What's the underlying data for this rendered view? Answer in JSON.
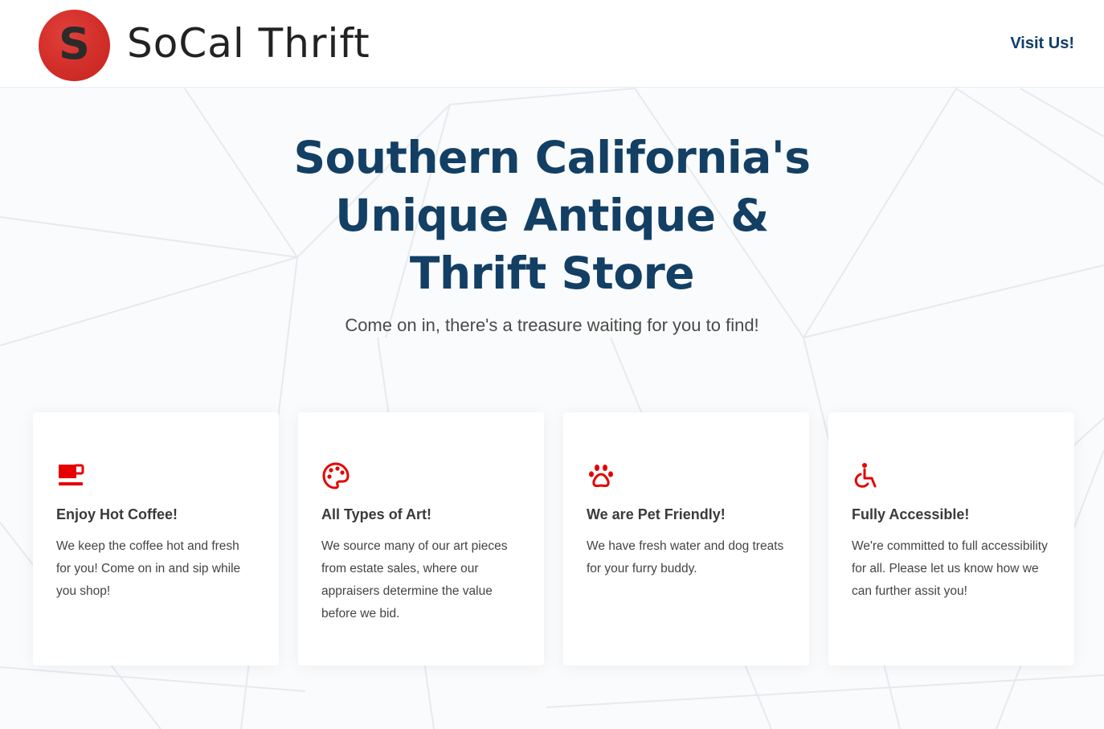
{
  "header": {
    "logo_letter": "S",
    "logo_text": "SoCal Thrift",
    "visit_link": "Visit Us!"
  },
  "hero": {
    "title": "Southern California's Unique Antique & Thrift Store",
    "subtitle": "Come on in, there's a treasure waiting for you to find!"
  },
  "features": [
    {
      "icon": "coffee-cup-icon",
      "title": "Enjoy Hot Coffee!",
      "text": "We keep the coffee hot and fresh for you! Come on in and sip while you shop!"
    },
    {
      "icon": "palette-icon",
      "title": "All Types of Art!",
      "text": "We source many of our art pieces from estate sales, where our appraisers determine the value before we bid."
    },
    {
      "icon": "paw-icon",
      "title": "We are Pet Friendly!",
      "text": "We have fresh water and dog treats for your furry buddy."
    },
    {
      "icon": "wheelchair-icon",
      "title": "Fully Accessible!",
      "text": "We're committed to full accessibility for all. Please let us know how we can further assit you!"
    }
  ],
  "colors": {
    "brand_red": "#d12c28",
    "heading_blue": "#133f64",
    "icon_red": "#e60000",
    "background": "#fafbfc"
  }
}
